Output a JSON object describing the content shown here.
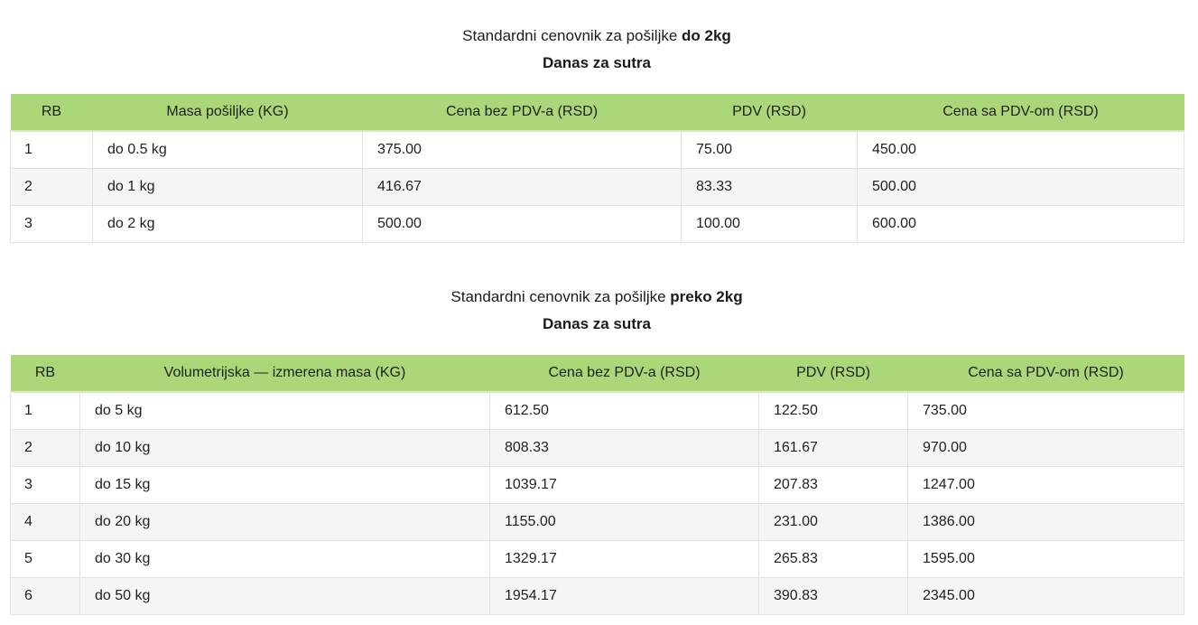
{
  "table1": {
    "title_prefix": "Standardni cenovnik za pošiljke ",
    "title_strong": "do 2kg",
    "subtitle": "Danas za sutra",
    "headers": [
      "RB",
      "Masa pošiljke (KG)",
      "Cena bez PDV-a (RSD)",
      "PDV (RSD)",
      "Cena sa PDV-om (RSD)"
    ],
    "rows": [
      [
        "1",
        "do 0.5 kg",
        "375.00",
        "75.00",
        "450.00"
      ],
      [
        "2",
        "do 1 kg",
        "416.67",
        "83.33",
        "500.00"
      ],
      [
        "3",
        "do 2 kg",
        "500.00",
        "100.00",
        "600.00"
      ]
    ]
  },
  "table2": {
    "title_prefix": "Standardni cenovnik za pošiljke ",
    "title_strong": "preko 2kg",
    "subtitle": "Danas za sutra",
    "headers": [
      "RB",
      "Volumetrijska — izmerena masa (KG)",
      "Cena bez PDV-a (RSD)",
      "PDV (RSD)",
      "Cena sa PDV-om (RSD)"
    ],
    "rows": [
      [
        "1",
        "do 5 kg",
        "612.50",
        "122.50",
        "735.00"
      ],
      [
        "2",
        "do 10 kg",
        "808.33",
        "161.67",
        "970.00"
      ],
      [
        "3",
        "do 15 kg",
        "1039.17",
        "207.83",
        "1247.00"
      ],
      [
        "4",
        "do 20 kg",
        "1155.00",
        "231.00",
        "1386.00"
      ],
      [
        "5",
        "do 30 kg",
        "1329.17",
        "265.83",
        "1595.00"
      ],
      [
        "6",
        "do 50 kg",
        "1954.17",
        "390.83",
        "2345.00"
      ]
    ]
  }
}
